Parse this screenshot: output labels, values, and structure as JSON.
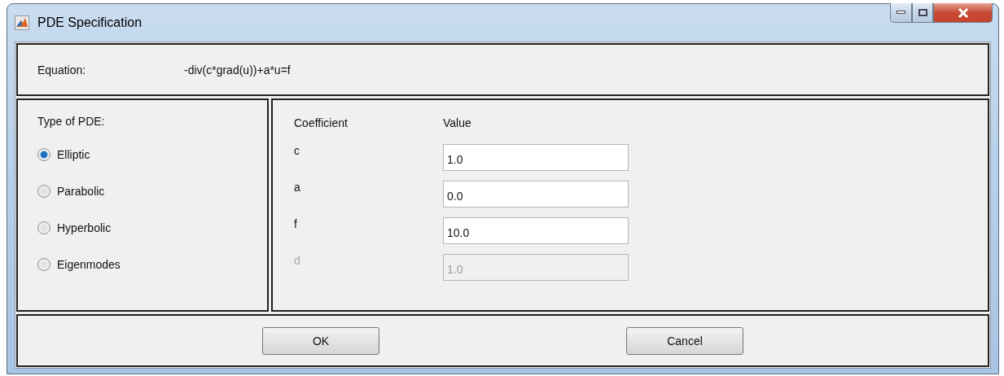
{
  "window": {
    "title": "PDE Specification"
  },
  "equation": {
    "label": "Equation:",
    "value": "-div(c*grad(u))+a*u=f"
  },
  "pde_type": {
    "label": "Type of PDE:",
    "options": [
      {
        "label": "Elliptic",
        "selected": true
      },
      {
        "label": "Parabolic",
        "selected": false
      },
      {
        "label": "Hyperbolic",
        "selected": false
      },
      {
        "label": "Eigenmodes",
        "selected": false
      }
    ]
  },
  "coefficients": {
    "columns": [
      "Coefficient",
      "Value"
    ],
    "rows": [
      {
        "name": "c",
        "value": "1.0",
        "disabled": false
      },
      {
        "name": "a",
        "value": "0.0",
        "disabled": false
      },
      {
        "name": "f",
        "value": "10.0",
        "disabled": false
      },
      {
        "name": "d",
        "value": "1.0",
        "disabled": true
      }
    ]
  },
  "buttons": [
    "OK",
    "Cancel"
  ]
}
